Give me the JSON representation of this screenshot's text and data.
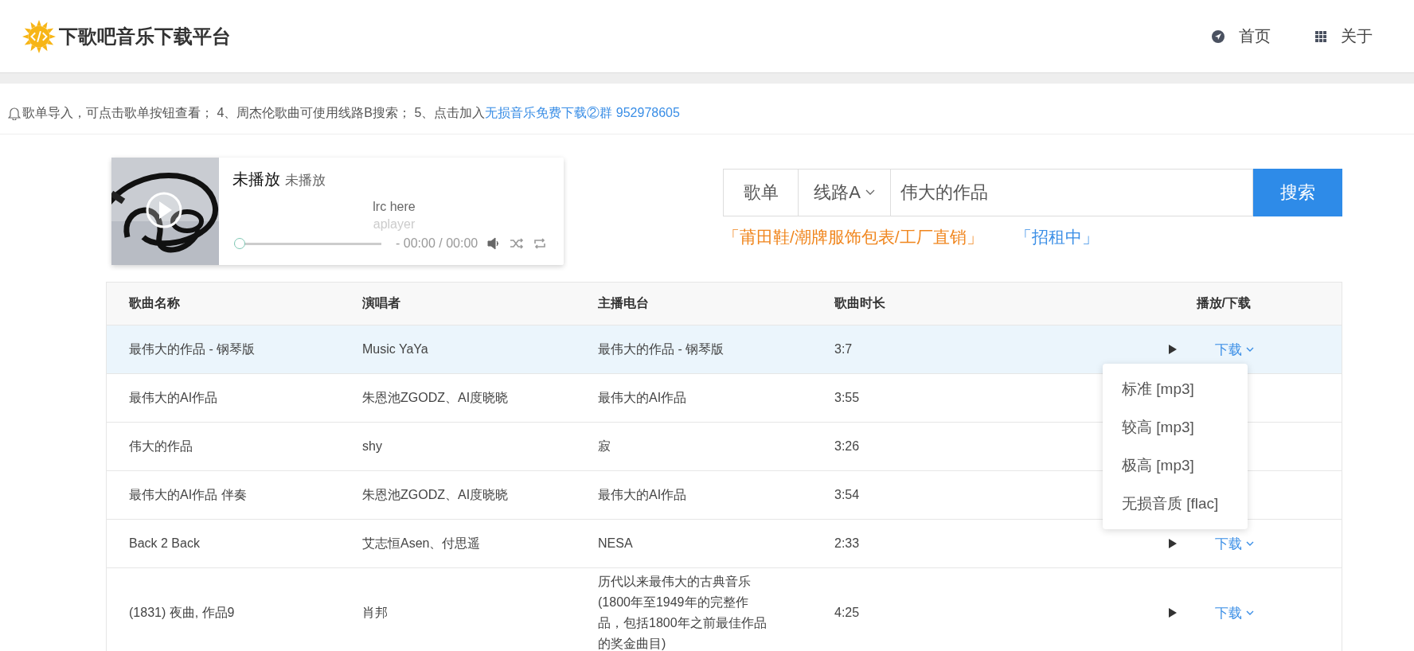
{
  "header": {
    "title": "下歌吧音乐下载平台",
    "nav": [
      {
        "kind": "home",
        "label": "首页"
      },
      {
        "kind": "about",
        "label": "关于"
      }
    ]
  },
  "notice": {
    "text": "歌单导入，可点击歌单按钮查看； 4、周杰伦歌曲可使用线路B搜索； 5、点击加入",
    "link": "无损音乐免费下载②群 952978605"
  },
  "player": {
    "title": "未播放",
    "artist": "未播放",
    "lyrics": [
      "lrc here",
      "aplayer"
    ],
    "level": 0,
    "time": "- 00:00 / 00:00"
  },
  "search": {
    "playlist_button": "歌单",
    "route": "线路A",
    "value": "伟大的作品",
    "button": "搜索"
  },
  "ads": [
    {
      "text": "「莆田鞋/潮牌服饰包表/工厂直销」",
      "color": "#f0861e"
    },
    {
      "text": "「招租中」",
      "color": "#3a8ee6"
    }
  ],
  "table": {
    "columns": [
      "歌曲名称",
      "演唱者",
      "主播电台",
      "歌曲时长",
      "播放/下载"
    ],
    "rows": [
      {
        "cells": [
          "最伟大的作品 - 钢琴版",
          "Music YaYa",
          "最伟大的作品 - 钢琴版",
          "3:7"
        ],
        "selected": true,
        "download": "下载"
      },
      {
        "cells": [
          "最伟大的AI作品",
          "朱恩池ZGODZ、AI度晓晓",
          "最伟大的AI作品",
          "3:55"
        ],
        "selected": false
      },
      {
        "cells": [
          "伟大的作品",
          "shy",
          "寂",
          "3:26"
        ],
        "selected": false
      },
      {
        "cells": [
          "最伟大的AI作品 伴奏",
          "朱恩池ZGODZ、AI度晓晓",
          "最伟大的AI作品",
          "3:54"
        ],
        "selected": false
      },
      {
        "cells": [
          "Back 2 Back",
          "艾志恒Asen、付思遥",
          "NESA",
          "2:33"
        ],
        "selected": false,
        "download": "下载"
      },
      {
        "cells": [
          "(1831) 夜曲, 作品9",
          "肖邦",
          "历代以来最伟大的古典音乐 (1800年至1949年的完整作品，包括1800年之前最佳作品的奖金曲目)",
          "4:25"
        ],
        "selected": false,
        "download": "下载"
      }
    ]
  },
  "download_menu": {
    "open": true,
    "items": [
      "标准 [mp3]",
      "较高 [mp3]",
      "极高 [mp3]",
      "无损音质 [flac]"
    ]
  }
}
